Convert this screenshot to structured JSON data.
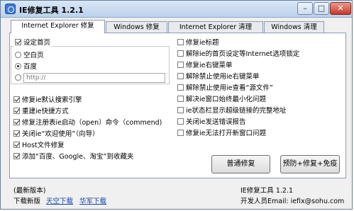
{
  "window": {
    "title": "IE修复工具 1.2.1",
    "min_label": "–",
    "max_label": "□",
    "close_label": "✕"
  },
  "tabs": [
    {
      "label": "Internet Explorer 修复"
    },
    {
      "label": "Windows 修复"
    },
    {
      "label": "Internet Explorer 清理"
    },
    {
      "label": "Windows 清理"
    }
  ],
  "homepage": {
    "set_label": "设定首页",
    "options": [
      "空白页",
      "百度"
    ],
    "url_placeholder": "http://"
  },
  "left_checks": [
    "修复ie默认搜索引擎",
    "重建ie快捷方式",
    "修复注册表ie启动（open）命令（commend)",
    "关闭ie“欢迎使用”（向导）",
    "Host文件修复",
    "添加“百度、Google、淘宝”到收藏夹"
  ],
  "right_checks": [
    "修复ie标题",
    "解除ie的首页设定等Internet选项锁定",
    "修复ie右键菜单",
    "解除禁止使用ie右键菜单",
    "解除禁止使用ie查看“源文件”",
    "解决ie窗口始终最小化问题",
    "ie状态栏显示超级链接的完整地址",
    "关闭ie发送错误报告",
    "修复ie无法打开新窗口问题"
  ],
  "buttons": {
    "normal_repair": "普通修复",
    "immune_repair": "预防+修复+免疫"
  },
  "footer": {
    "latest_version": "(最新版本)",
    "download_label": "下载新版",
    "link_tianyi": "天空下载",
    "link_huajun": "华军下载",
    "app_version": "IE修复工具 1.2.1",
    "developer": "开发人员Email: iefix@sohu.com"
  }
}
